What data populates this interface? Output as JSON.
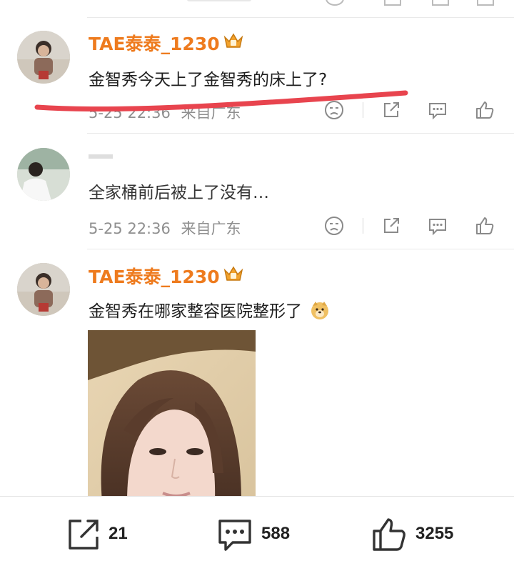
{
  "comments": [
    {
      "username": "TAE泰泰_1230",
      "text": "金智秀今天上了金智秀的床上了?",
      "time": "5-25 22:36",
      "location": "来自广东"
    },
    {
      "username": "",
      "text": "全家桶前后被上了没有…",
      "time": "5-25 22:36",
      "location": "来自广东"
    },
    {
      "username": "TAE泰泰_1230",
      "text": "金智秀在哪家整容医院整形了",
      "emoji": "doge-emoji"
    }
  ],
  "bottom_bar": {
    "repost_count": "21",
    "comment_count": "588",
    "like_count": "3255"
  },
  "colors": {
    "username": "#ee7b1e",
    "underline_annotation": "#e8444e",
    "meta_text": "#8f8f8f"
  },
  "icons": [
    "dislike-face-icon",
    "share-icon",
    "comment-icon",
    "like-icon",
    "vip-crown-icon"
  ]
}
